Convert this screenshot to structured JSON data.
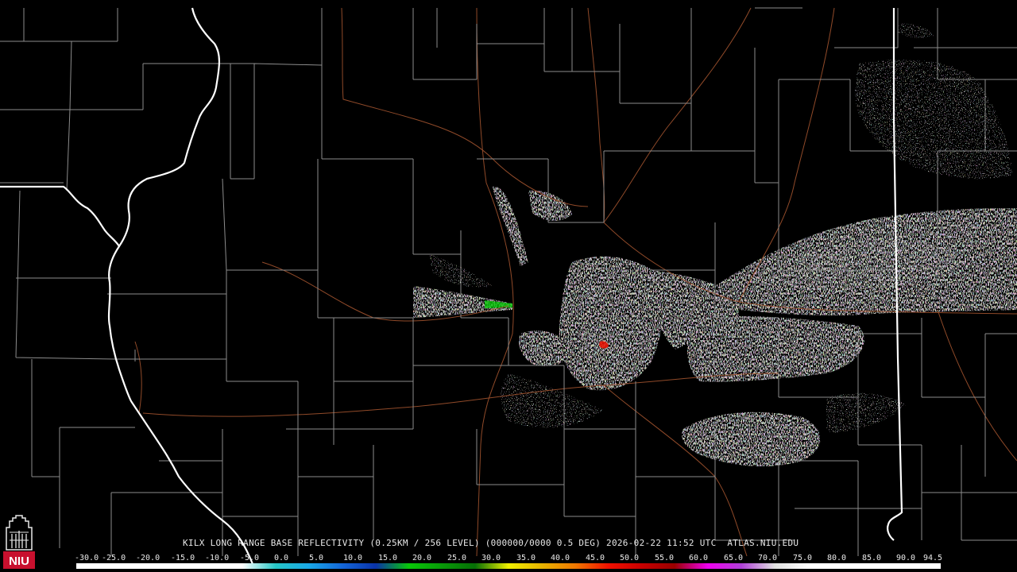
{
  "product": {
    "caption": "KILX LONG RANGE BASE REFLECTIVITY (0.25KM / 256 LEVEL) (000000/0000 0.5 DEG) 2026-02-22 11:52 UTC  ATLAS.NIU.EDU",
    "station": "KILX",
    "datetime": "2026-02-22 11:52 UTC",
    "source": "ATLAS.NIU.EDU"
  },
  "logo": {
    "text": "NIU",
    "icon": "niu-altgeld-tower-icon",
    "color": "#c8102e"
  },
  "color_scale": {
    "labels": [
      "-30.0",
      "-25.0",
      "-20.0",
      "-15.0",
      "-10.0",
      "-5.0",
      "0.0",
      "5.0",
      "10.0",
      "15.0",
      "20.0",
      "25.0",
      "30.0",
      "35.0",
      "40.0",
      "45.0",
      "50.0",
      "55.0",
      "60.0",
      "65.0",
      "70.0",
      "75.0",
      "80.0",
      "85.0",
      "90.0",
      "94.5"
    ],
    "colors": [
      "#ffffff",
      "#ffffff",
      "#ffffff",
      "#ffffff",
      "#ffffff",
      "#ffffff",
      "#26c6c6",
      "#19a8e8",
      "#1466d8",
      "#0a32a8",
      "#08c808",
      "#089a08",
      "#066e06",
      "#f0f000",
      "#e8b400",
      "#f07800",
      "#f01000",
      "#c80000",
      "#9a0000",
      "#f000f0",
      "#b040d8",
      "#e0e0e0",
      "#ffffff",
      "#ffffff",
      "#ffffff",
      "#ffffff"
    ]
  },
  "map_colors": {
    "background": "#000000",
    "county_lines": "#8c8c8c",
    "state_lines": "#ffffff",
    "roads": "#a0522d"
  }
}
